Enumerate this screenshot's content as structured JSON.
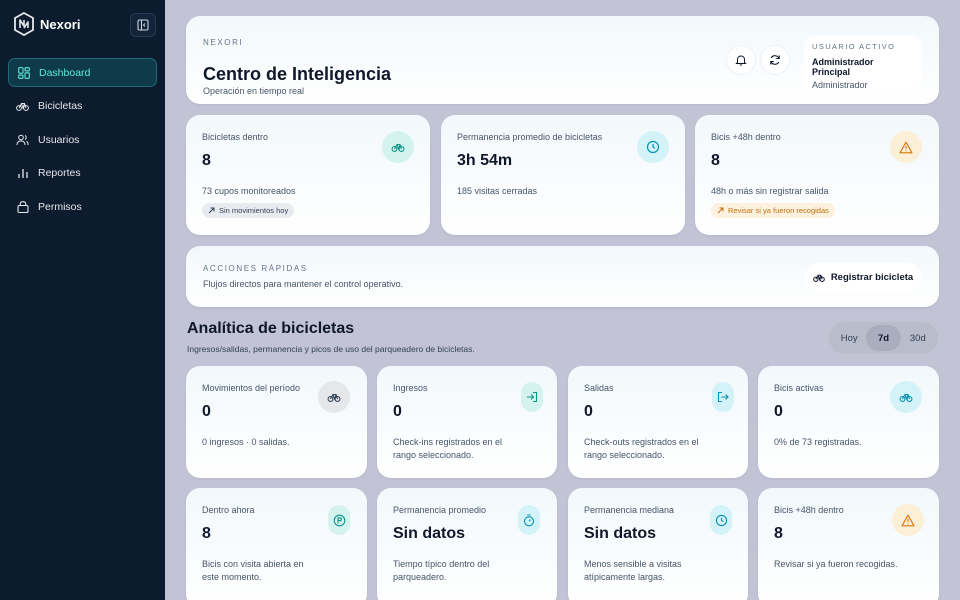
{
  "brand": {
    "name": "Nexori"
  },
  "sidebar": {
    "items": [
      {
        "label": "Dashboard",
        "icon": "dashboard-icon",
        "active": true
      },
      {
        "label": "Bicicletas",
        "icon": "bicycle-icon",
        "active": false
      },
      {
        "label": "Usuarios",
        "icon": "users-icon",
        "active": false
      },
      {
        "label": "Reportes",
        "icon": "bar-chart-icon",
        "active": false
      },
      {
        "label": "Permisos",
        "icon": "lock-icon",
        "active": false
      }
    ]
  },
  "header": {
    "eyebrow": "NEXORI",
    "title": "Centro de Inteligencia",
    "subtitle": "Operación en tiempo real",
    "user": {
      "eyebrow": "USUARIO ACTIVO",
      "name": "Administrador Principal",
      "role": "Administrador"
    }
  },
  "top_stats": [
    {
      "label": "Bicicletas dentro",
      "value": "8",
      "desc": "73 cupos monitoreados",
      "chip": "Sin movimientos hoy",
      "icon": "bicycle-icon"
    },
    {
      "label": "Permanencia promedio de bicicletas",
      "value": "3h 54m",
      "desc": "185 visitas cerradas",
      "icon": "clock-icon"
    },
    {
      "label": "Bicis +48h dentro",
      "value": "8",
      "desc": "48h o más sin registrar salida",
      "chip": "Revisar si ya fueron recogidas",
      "icon": "warning-icon"
    }
  ],
  "actions": {
    "eyebrow": "ACCIONES RÁPIDAS",
    "subtitle": "Flujos directos para mantener el control operativo.",
    "button": "Registrar bicicleta"
  },
  "analytics": {
    "title": "Analítica de bicicletas",
    "subtitle": "Ingresos/salidas, permanencia y picos de uso del parqueadero de bicicletas.",
    "ranges": [
      "Hoy",
      "7d",
      "30d"
    ],
    "selected_range": "7d",
    "row1": [
      {
        "label": "Movimientos del período",
        "value": "0",
        "desc": "0 ingresos · 0 salidas.",
        "icon": "bicycle-icon"
      },
      {
        "label": "Ingresos",
        "value": "0",
        "desc": "Check-ins registrados en el rango seleccionado.",
        "icon": "login-icon"
      },
      {
        "label": "Salidas",
        "value": "0",
        "desc": "Check-outs registrados en el rango seleccionado.",
        "icon": "logout-icon"
      },
      {
        "label": "Bicis activas",
        "value": "0",
        "desc": "0% de 73 registradas.",
        "icon": "bicycle-icon"
      }
    ],
    "row2": [
      {
        "label": "Dentro ahora",
        "value": "8",
        "desc": "Bicis con visita abierta en este momento.",
        "icon": "parking-icon"
      },
      {
        "label": "Permanencia promedio",
        "value": "Sin datos",
        "desc": "Tiempo típico dentro del parqueadero.",
        "icon": "timer-icon"
      },
      {
        "label": "Permanencia mediana",
        "value": "Sin datos",
        "desc": "Menos sensible a visitas atípicamente largas.",
        "icon": "clock-icon"
      },
      {
        "label": "Bicis +48h dentro",
        "value": "8",
        "desc": "Revisar si ya fueron recogidas.",
        "icon": "warning-icon"
      }
    ]
  },
  "colors": {
    "sidebar": "#0d1b2e",
    "accent": "#14b8a6",
    "active_nav": "#5eead4",
    "warning": "#f59e0b",
    "background": "#c3c3d6"
  }
}
